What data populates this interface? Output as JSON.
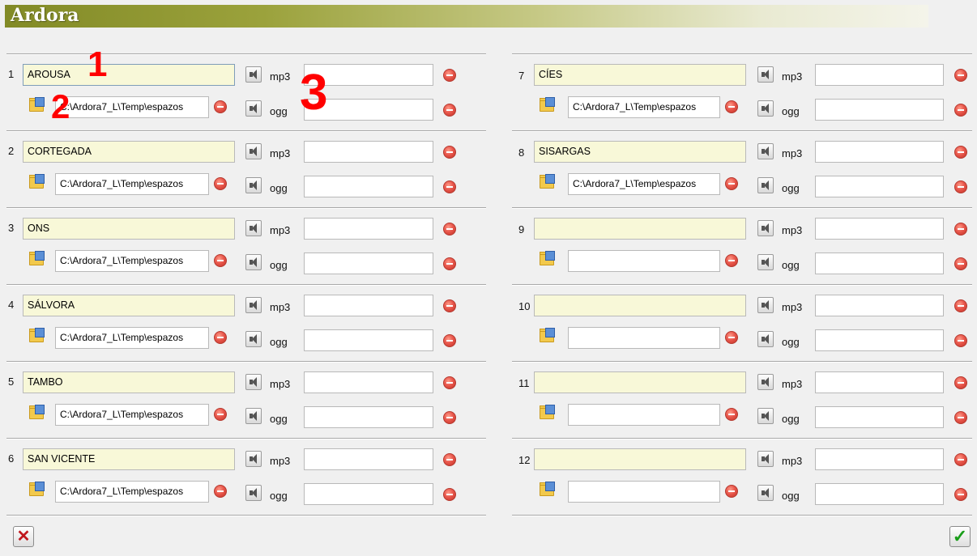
{
  "window": {
    "title": "Ardora"
  },
  "formats": {
    "mp3": "mp3",
    "ogg": "ogg"
  },
  "icons": {
    "sound": "speaker-icon",
    "delete": "minus-circle-icon",
    "browse": "folder-browse-icon",
    "cancel": "red-x-icon",
    "ok": "green-check-icon"
  },
  "annotations": [
    "1",
    "2",
    "3"
  ],
  "items": [
    {
      "num": "1",
      "name": "AROUSA",
      "path": "C:\\Ardora7_L\\Temp\\espazos",
      "mp3": "",
      "ogg": ""
    },
    {
      "num": "2",
      "name": "CORTEGADA",
      "path": "C:\\Ardora7_L\\Temp\\espazos",
      "mp3": "",
      "ogg": ""
    },
    {
      "num": "3",
      "name": "ONS",
      "path": "C:\\Ardora7_L\\Temp\\espazos",
      "mp3": "",
      "ogg": ""
    },
    {
      "num": "4",
      "name": "SÁLVORA",
      "path": "C:\\Ardora7_L\\Temp\\espazos",
      "mp3": "",
      "ogg": ""
    },
    {
      "num": "5",
      "name": "TAMBO",
      "path": "C:\\Ardora7_L\\Temp\\espazos",
      "mp3": "",
      "ogg": ""
    },
    {
      "num": "6",
      "name": "SAN VICENTE",
      "path": "C:\\Ardora7_L\\Temp\\espazos",
      "mp3": "",
      "ogg": ""
    },
    {
      "num": "7",
      "name": "CÍES",
      "path": "C:\\Ardora7_L\\Temp\\espazos",
      "mp3": "",
      "ogg": ""
    },
    {
      "num": "8",
      "name": "SISARGAS",
      "path": "C:\\Ardora7_L\\Temp\\espazos",
      "mp3": "",
      "ogg": ""
    },
    {
      "num": "9",
      "name": "",
      "path": "",
      "mp3": "",
      "ogg": ""
    },
    {
      "num": "10",
      "name": "",
      "path": "",
      "mp3": "",
      "ogg": ""
    },
    {
      "num": "11",
      "name": "",
      "path": "",
      "mp3": "",
      "ogg": ""
    },
    {
      "num": "12",
      "name": "",
      "path": "",
      "mp3": "",
      "ogg": ""
    }
  ]
}
